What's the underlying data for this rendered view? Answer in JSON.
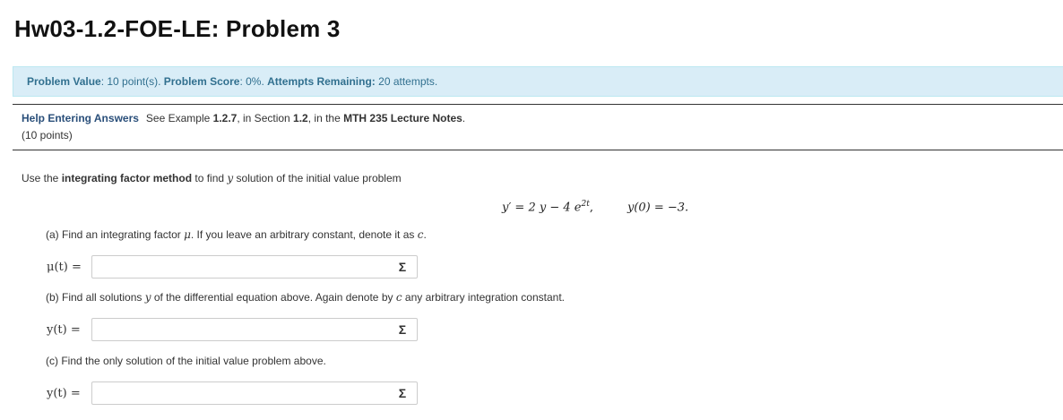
{
  "header": {
    "title": "Hw03-1.2-FOE-LE: Problem 3"
  },
  "info_bar": {
    "value_label": "Problem Value",
    "value_text": ": 10 point(s). ",
    "score_label": "Problem Score",
    "score_text": ": 0%. ",
    "attempts_label": "Attempts Remaining:",
    "attempts_text": " 20 attempts."
  },
  "help": {
    "link_text": "Help Entering Answers",
    "see_text": "See Example ",
    "example_ref": "1.2.7",
    "in_section_text": ", in Section ",
    "section_ref": "1.2",
    "in_the_text": ", in the ",
    "notes_ref": "MTH 235 Lecture Notes",
    "end_text": ".",
    "points": "(10 points)"
  },
  "problem": {
    "intro_a": "Use the ",
    "intro_bold": "integrating factor method",
    "intro_b": " to find ",
    "intro_var": "y",
    "intro_c": " solution of the initial value problem",
    "eq_lhs": "y′ = 2 y − 4 e",
    "eq_exp": "2t",
    "eq_comma": ",",
    "eq_ic": "y(0) = −3.",
    "part_a_text": "(a) Find an integrating factor ",
    "part_a_var": "μ",
    "part_a_text2": ". If you leave an arbitrary constant, denote it as ",
    "part_a_const": "c",
    "part_a_end": ".",
    "label_a": "μ(t) =",
    "part_b_text": "(b) Find all solutions ",
    "part_b_var": "y",
    "part_b_text2": " of the differential equation above. Again denote by ",
    "part_b_const": "c",
    "part_b_text3": " any arbitrary integration constant.",
    "label_b": "y(t) =",
    "part_c_text": "(c) Find the only solution of the initial value problem above.",
    "label_c": "y(t) =",
    "answer_a": "",
    "answer_b": "",
    "answer_c": "",
    "sigma_glyph": "Σ"
  },
  "icons": {
    "equation_editor": "sigma-icon"
  },
  "colors": {
    "info_bg": "#d9edf7",
    "info_text": "#31708f",
    "link": "#2a4f7a"
  }
}
